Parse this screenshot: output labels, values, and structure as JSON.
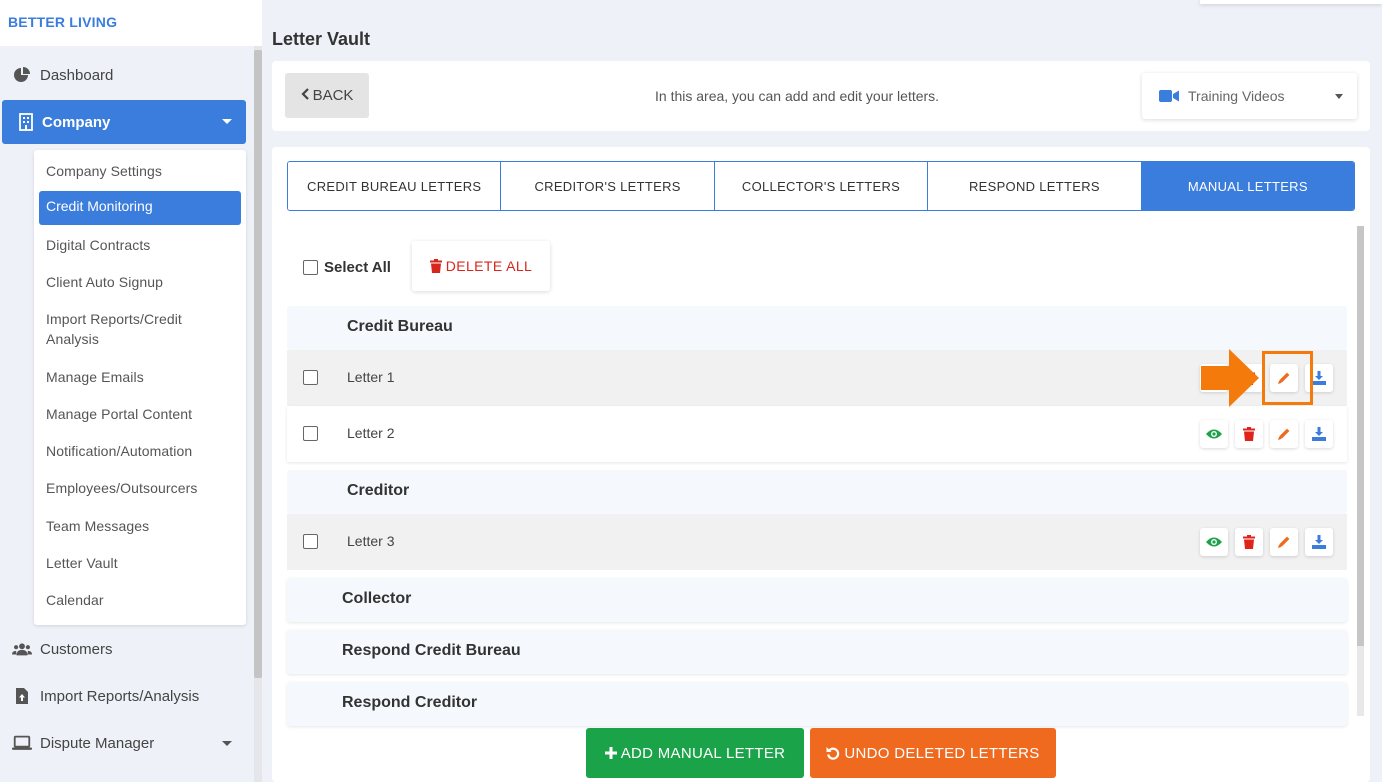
{
  "brand": "BETTER LIVING",
  "sidebar": {
    "dashboard": "Dashboard",
    "company": "Company",
    "company_sub": [
      "Company Settings",
      "Credit Monitoring",
      "Digital Contracts",
      "Client Auto Signup",
      "Import Reports/Credit",
      "Analysis",
      "Manage Emails",
      "Manage Portal Content",
      "Notification/Automation",
      "Employees/Outsourcers",
      "Team Messages",
      "Letter Vault",
      "Calendar"
    ],
    "customers": "Customers",
    "import_reports": "Import Reports/Analysis",
    "dispute_manager": "Dispute Manager"
  },
  "page": {
    "title": "Letter Vault",
    "back": "BACK",
    "info": "In this area, you can add and edit your letters.",
    "training": "Training Videos"
  },
  "tabs": [
    "CREDIT BUREAU LETTERS",
    "CREDITOR'S LETTERS",
    "COLLECTOR'S LETTERS",
    "RESPOND LETTERS",
    "MANUAL LETTERS"
  ],
  "active_tab": "MANUAL LETTERS",
  "controls": {
    "select_all": "Select All",
    "delete_all": "DELETE ALL"
  },
  "groups": {
    "credit_bureau": "Credit Bureau",
    "creditor": "Creditor",
    "collector": "Collector",
    "respond_credit_bureau": "Respond Credit Bureau",
    "respond_creditor": "Respond Creditor"
  },
  "letters": {
    "l1": "Letter 1",
    "l2": "Letter 2",
    "l3": "Letter 3"
  },
  "buttons": {
    "add_manual": "ADD MANUAL LETTER",
    "undo_deleted": "UNDO DELETED LETTERS"
  },
  "colors": {
    "primary": "#3b7ddd",
    "green": "#1ba34a",
    "orange": "#ef6a1f",
    "red": "#d9261c",
    "highlight": "#f47a0b"
  }
}
